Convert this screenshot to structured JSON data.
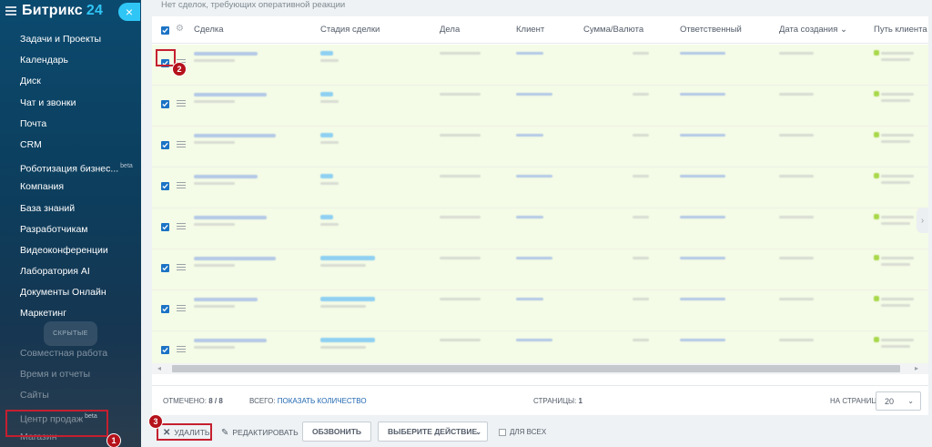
{
  "sidebar": {
    "logo_text": "Битрикс",
    "logo_num": "24",
    "collapse_icon": "×",
    "items": [
      {
        "label": "Задачи и Проекты"
      },
      {
        "label": "Календарь"
      },
      {
        "label": "Диск"
      },
      {
        "label": "Чат и звонки"
      },
      {
        "label": "Почта"
      },
      {
        "label": "CRM"
      },
      {
        "label": "Роботизация бизнес...",
        "badge": "beta"
      },
      {
        "label": "Компания"
      },
      {
        "label": "База знаний"
      },
      {
        "label": "Разработчикам"
      },
      {
        "label": "Видеоконференции"
      },
      {
        "label": "Лаборатория AI"
      },
      {
        "label": "Документы Онлайн"
      },
      {
        "label": "Маркетинг"
      }
    ],
    "hidden_label": "СКРЫТЫЕ",
    "hidden_items": [
      {
        "label": "Совместная работа"
      },
      {
        "label": "Время и отчеты"
      },
      {
        "label": "Сайты"
      },
      {
        "label": "Центр продаж",
        "badge": "beta"
      },
      {
        "label": "Магазин"
      }
    ]
  },
  "main": {
    "notice": "Нет сделок, требующих оперативной реакции"
  },
  "grid": {
    "columns": [
      {
        "label": "Сделка"
      },
      {
        "label": "Стадия сделки"
      },
      {
        "label": "Дела"
      },
      {
        "label": "Клиент"
      },
      {
        "label": "Сумма/Валюта"
      },
      {
        "label": "Ответственный"
      },
      {
        "label": "Дата создания"
      },
      {
        "label": "Путь клиента"
      }
    ],
    "sort_icon": "⌄",
    "row_count": 8,
    "rows_checked": true
  },
  "footer": {
    "selected_label": "ОТМЕЧЕНО:",
    "selected_value": "8 / 8",
    "total_label": "ВСЕГО:",
    "total_link": "ПОКАЗАТЬ КОЛИЧЕСТВО",
    "pages_label": "СТРАНИЦЫ:",
    "pages_value": "1",
    "per_page_label": "НА СТРАНИЦЕ:",
    "per_page_value": "20"
  },
  "actions": {
    "delete_label": "УДАЛИТЬ",
    "edit_label": "РЕДАКТИРОВАТЬ",
    "call_label": "ОБЗВОНИТЬ",
    "select_action_label": "ВЫБЕРИТЕ ДЕЙСТВИЕ",
    "for_all_label": "ДЛЯ ВСЕХ"
  },
  "annotations": {
    "step1": "1",
    "step2": "2",
    "step3": "3"
  },
  "colors": {
    "accent": "#2fc6f6",
    "highlight": "#c51f2f",
    "checkbox": "#1c73c5",
    "row_bg": "#f4fbe6"
  }
}
